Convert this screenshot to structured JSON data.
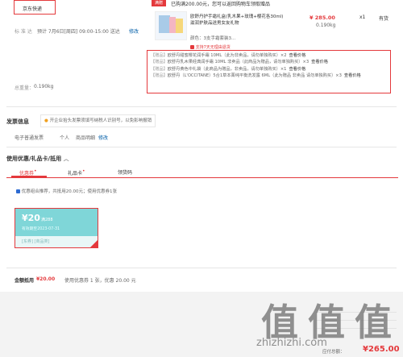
{
  "shipping": {
    "method": "京东快递",
    "label": "标 准 达",
    "time": "预计 7月6日[周四] 09:00-15:00 送达",
    "edit": "修改",
    "weight_label": "总重量：",
    "weight": "0.190kg"
  },
  "promo": {
    "badge": "满赠",
    "text": "已购满200.00元，您可以返回购物车领取赠品"
  },
  "product": {
    "name": "欧舒丹护手霜礼盒(乳木果+玫瑰+樱花各30ml) 滋润护肤品送男女友礼物",
    "color": "颜色：3支手霜套装3...",
    "service": "支持7天无理由退货",
    "price": "¥ 285.00",
    "qty": "x1",
    "weight": "0.190kg",
    "stock": "有货"
  },
  "gifts": [
    {
      "tag": "【赠品】",
      "text": "欧舒丹甜蜜樱花润手霜 10ML（此为非卖品，请勿单独购买）×2",
      "link": "查看价格"
    },
    {
      "tag": "【赠品】",
      "text": "欧舒丹乳木果经典润手霜 10ML 非卖品（此商品为赠品，请勿单独购买）×3",
      "link": "查看价格"
    },
    {
      "tag": "【赠品】",
      "text": "欧舒丹黄色中礼袋（此商品为赠品，非卖品，请勿单独购买）×1",
      "link": "查看价格"
    },
    {
      "tag": "【赠品】",
      "text": "欧舒丹（L'OCCITANE）5合1草本菁纯平衡洗发露 6ML（此为赠品 非卖品 请勿单独购买）×3",
      "link": "查看价格"
    }
  ],
  "invoice": {
    "title": "发票信息",
    "tip": "开企业抬头发票须填写纳税人识别号，以免影响报销",
    "type": "电子普通发票",
    "person": "个人",
    "detail": "商品明细",
    "edit": "修改"
  },
  "discount": {
    "title": "使用优惠/礼品卡/抵用",
    "tabs": [
      "优惠券",
      "礼品卡",
      "领货码"
    ],
    "combo_text": "优惠组合推荐，共抵用20.00元；使用优惠券1张",
    "coupon": {
      "amount": "¥20",
      "condition": "满288",
      "validity": "有效期至2023-07-31",
      "tags": "[东券]  [商品类]"
    },
    "summary_label": "金额抵用",
    "summary_amount": "¥20.00",
    "summary_detail": "使用优惠券 1 张，优惠 20.00 元"
  },
  "footer": {
    "pay_label": "应付总额：",
    "pay_amount": "¥265.00",
    "watermark": "值 值 值",
    "watermark_url": "zhizhizhi.com"
  },
  "colors": {
    "accent": "#e4393c",
    "link": "#005ea7",
    "coupon": "#7fd6d8"
  }
}
